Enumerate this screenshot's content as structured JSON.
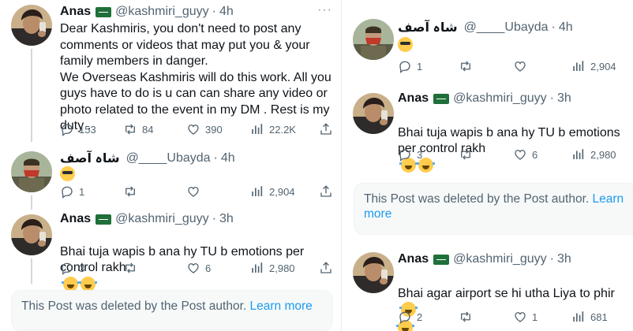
{
  "left": {
    "posts": [
      {
        "name": "Anas",
        "handle": "@kashmiri_guyy",
        "time": "4h",
        "more": "···",
        "text": "Dear Kashmiris, you don't need to post any comments or videos that may put you & your family members in danger.\nWe Overseas Kashmiris will do this work. All you guys have to do is u can can share any video or photo related to the event in my DM . Rest is my duty .",
        "replies": "153",
        "reposts": "84",
        "likes": "390",
        "views": "22.2K"
      },
      {
        "name": "شاہ آصف",
        "handle": "@____Ubayda",
        "time": "4h",
        "replies": "1",
        "reposts": "",
        "likes": "",
        "views": "2,904"
      },
      {
        "name": "Anas",
        "handle": "@kashmiri_guyy",
        "time": "3h",
        "text": "Bhai tuja wapis b ana hy TU b emotions per control rakh",
        "replies": "3",
        "reposts": "",
        "likes": "6",
        "views": "2,980"
      }
    ],
    "deleted": {
      "text": "This Post was deleted by the Post author.",
      "link": "Learn more"
    }
  },
  "right": {
    "posts": [
      {
        "name": "شاہ آصف",
        "handle": "@____Ubayda",
        "time": "4h",
        "replies": "1",
        "reposts": "",
        "likes": "",
        "views": "2,904"
      },
      {
        "name": "Anas",
        "handle": "@kashmiri_guyy",
        "time": "3h",
        "text": "Bhai tuja wapis b ana hy TU b emotions per control rakh",
        "replies": "3",
        "reposts": "",
        "likes": "6",
        "views": "2,980"
      },
      {
        "name": "Anas",
        "handle": "@kashmiri_guyy",
        "time": "3h",
        "text": "Bhai agar airport se hi utha Liya to phir",
        "replies": "2",
        "reposts": "",
        "likes": "1",
        "views": "681"
      }
    ],
    "deleted": {
      "text": "This Post was deleted by the Post author.",
      "link": "Learn more"
    }
  },
  "separator": "·",
  "icons": {
    "reply": "reply-icon",
    "repost": "repost-icon",
    "like": "heart-icon",
    "views": "views-icon",
    "share": "share-icon",
    "flag": "saudi-flag-icon",
    "emoji_cool": "sunglasses-emoji-icon",
    "emoji_laugh": "laughing-tears-emoji-icon"
  },
  "colors": {
    "text": "#0f1419",
    "muted": "#536471",
    "link": "#1d9bf0",
    "thread_line": "#cfd9de"
  }
}
